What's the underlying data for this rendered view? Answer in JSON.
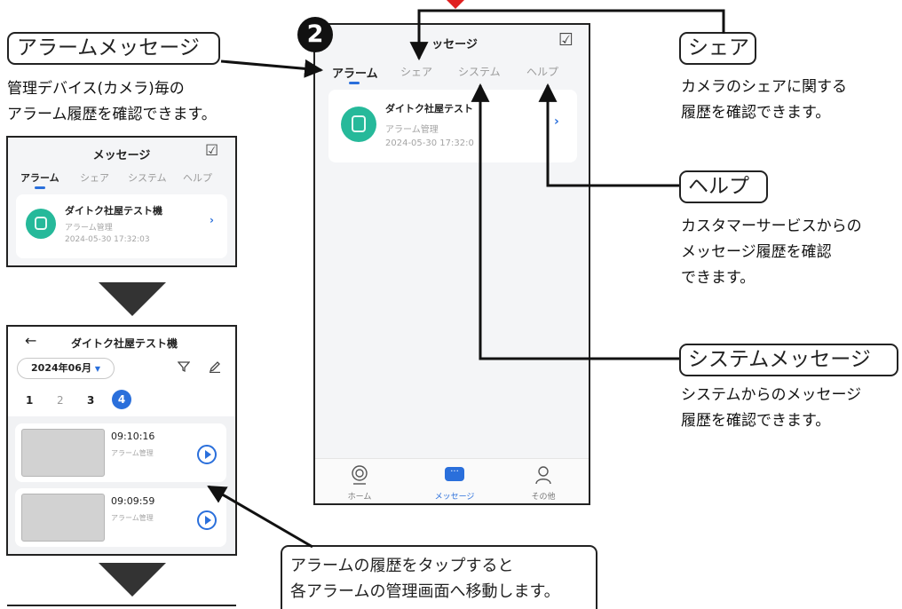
{
  "step_badge": "2",
  "labels": {
    "alarm": "アラームメッセージ",
    "alarm_desc": "管理デバイス(カメラ)毎の\nアラーム履歴を確認できます。",
    "share": "シェア",
    "share_desc": "カメラのシェアに関する\n履歴を確認できます。",
    "help": "ヘルプ",
    "help_desc": "カスタマーサービスからの\nメッセージ履歴を確認\nできます。",
    "system": "システムメッセージ",
    "system_desc": "システムからのメッセージ\n履歴を確認できます。",
    "tap_note_line1": "アラームの履歴をタップすると",
    "tap_note_line2": "各アラームの管理画面へ移動します。"
  },
  "message_screen": {
    "title": "メッセージ",
    "title_cropped": "ッセージ",
    "tabs": [
      "アラーム",
      "シェア",
      "システム",
      "ヘルプ"
    ],
    "active_tab": 0,
    "item": {
      "title": "ダイトク社屋テスト機",
      "title_cropped": "ダイトク社屋テスト",
      "subtitle": "アラーム管理",
      "time": "2024-05-30 17:32:03",
      "time_cropped": "2024-05-30 17:32:0"
    },
    "nav": [
      "ホーム",
      "メッセージ",
      "その他"
    ],
    "active_nav": 1
  },
  "detail_screen": {
    "back": "←",
    "title": "ダイトク社屋テスト機",
    "month": "2024年06月",
    "month_arrow": "▼",
    "days": [
      "1",
      "2",
      "3",
      "4"
    ],
    "selected_day": 3,
    "records": [
      {
        "time": "09:10:16",
        "label": "アラーム管理"
      },
      {
        "time": "09:09:59",
        "label": "アラーム管理"
      }
    ]
  },
  "colors": {
    "accent": "#2a6fdb",
    "camera_icon": "#26b99a",
    "marker_red": "#e02020",
    "phone_bg": "#f4f5f7"
  },
  "icons": [
    "checklist-icon",
    "chevron-right-icon",
    "camera-icon",
    "filter-icon",
    "edit-icon",
    "play-icon",
    "home-icon",
    "message-icon",
    "profile-icon",
    "down-triangle-icon"
  ]
}
